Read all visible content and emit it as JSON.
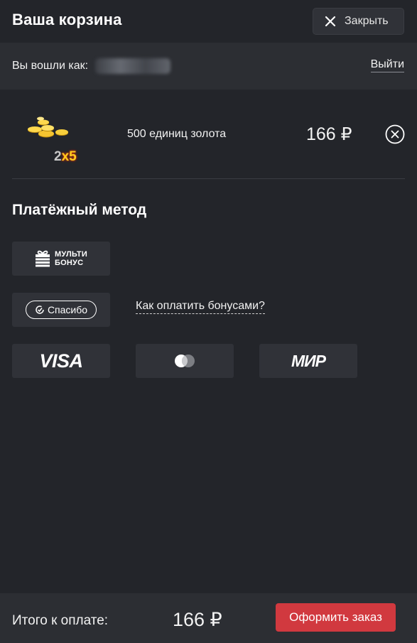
{
  "header": {
    "title": "Ваша корзина",
    "close_label": "Закрыть"
  },
  "user": {
    "logged_in_as_label": "Вы вошли как:",
    "logout_label": "Выйти"
  },
  "cart": {
    "items": [
      {
        "image_icon": "gold-coins-icon",
        "multiplier_number": "2",
        "multiplier_badge": "x5",
        "name": "500 единиц золота",
        "price": "166 ₽"
      }
    ]
  },
  "payment": {
    "title": "Платёжный метод",
    "methods": {
      "multibonus": {
        "line1": "МУЛЬТИ",
        "line2": "БОНУС"
      },
      "spasibo": {
        "label": "Спасибо"
      },
      "visa": {
        "label": "VISA"
      },
      "mastercard": {
        "icon": "mastercard-icon"
      },
      "mir": {
        "label": "МИР"
      }
    },
    "bonus_help_link": "Как оплатить бонусами?"
  },
  "footer": {
    "total_label": "Итого к оплате:",
    "total_value": "166 ₽",
    "order_button": "Оформить заказ"
  },
  "colors": {
    "background": "#23252a",
    "panel": "#2c2e33",
    "tile": "#303238",
    "accent_red": "#d1393f",
    "gold": "#ffce1f"
  }
}
